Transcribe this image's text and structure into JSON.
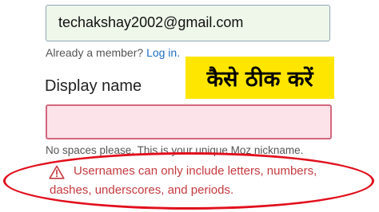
{
  "email_field": {
    "value": "techakshay2002@gmail.com"
  },
  "member_prompt": {
    "text": "Already a member?",
    "login_link": "Log in."
  },
  "overlay_banner": {
    "text": "कैसे ठीक करें"
  },
  "display_name": {
    "label": "Display name",
    "value": "",
    "hint": "No spaces please. This is your unique Moz nickname."
  },
  "error": {
    "icon": "warning-triangle-icon",
    "line1": "Usernames can only include letters, numbers,",
    "line2": "dashes, underscores, and periods."
  },
  "colors": {
    "email_field_bg": "#eef7ea",
    "error_field_bg": "#fce3ea",
    "error_field_border": "#d4687e",
    "error_text": "#c53a3f",
    "link": "#1f6fc4",
    "banner_bg": "#ffe600",
    "highlight_oval": "#e20f1d"
  }
}
